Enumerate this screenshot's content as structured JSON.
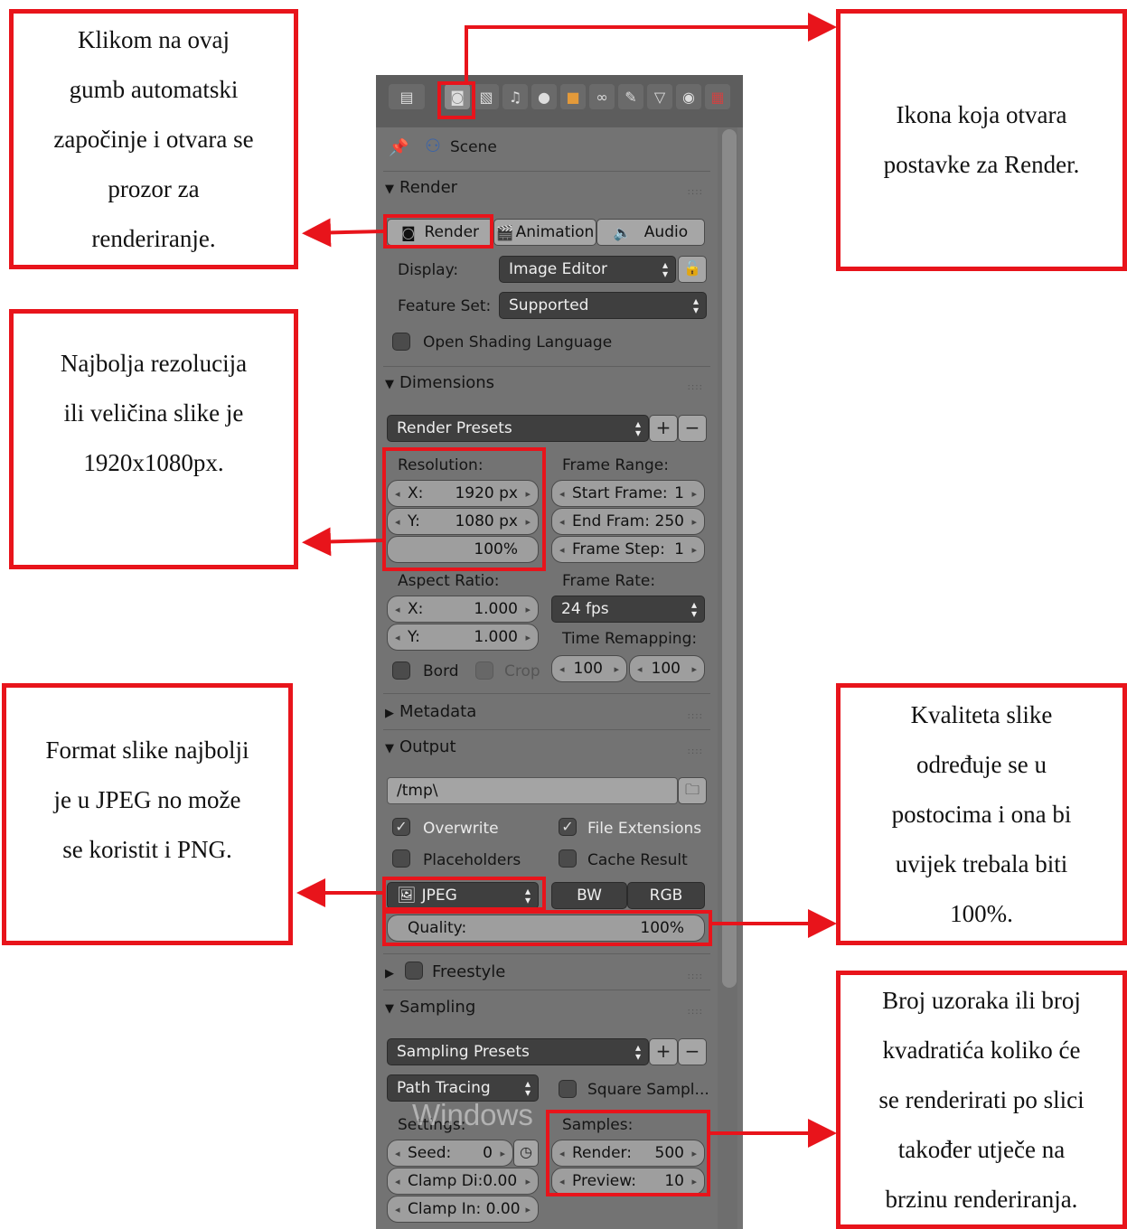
{
  "notes": {
    "render_button": [
      "Klikom na ovaj",
      "gumb automatski",
      "započinje i otvara se",
      "prozor za",
      "renderiranje."
    ],
    "render_icon": [
      "Ikona koja otvara",
      "postavke za Render."
    ],
    "resolution": [
      "Najbolja rezolucija",
      "ili veličina slike je",
      "1920x1080px."
    ],
    "format": [
      "Format slike najbolji",
      "je u JPEG no može",
      "se koristit i PNG."
    ],
    "quality": [
      "Kvaliteta slike",
      "određuje se u",
      "postocima i ona bi",
      "uvijek trebala biti",
      "100%."
    ],
    "samples": [
      "Broj uzoraka ili broj",
      "kvadratića koliko će",
      "se renderirati po slici",
      "također utječe na",
      "brzinu renderiranja."
    ]
  },
  "panel": {
    "scene_label": "Scene",
    "render_section": {
      "title": "Render",
      "render_btn": "Render",
      "animation_btn": "Animation",
      "audio_btn": "Audio",
      "display_label": "Display:",
      "display_value": "Image Editor",
      "feature_label": "Feature Set:",
      "feature_value": "Supported",
      "osl_label": "Open Shading Language"
    },
    "dimensions": {
      "title": "Dimensions",
      "presets": "Render Presets",
      "resolution_label": "Resolution:",
      "res_x_label": "X:",
      "res_x": "1920 px",
      "res_y_label": "Y:",
      "res_y": "1080 px",
      "res_pct": "100%",
      "frame_range_label": "Frame Range:",
      "start_frame_label": "Start Frame:",
      "start_frame": "1",
      "end_frame_label": "End Fram:",
      "end_frame": "250",
      "frame_step_label": "Frame Step:",
      "frame_step": "1",
      "aspect_label": "Aspect Ratio:",
      "asp_x_label": "X:",
      "asp_x": "1.000",
      "asp_y_label": "Y:",
      "asp_y": "1.000",
      "frame_rate_label": "Frame Rate:",
      "frame_rate": "24 fps",
      "time_remap_label": "Time Remapping:",
      "remap_old": "100",
      "remap_new": "100",
      "border_label": "Bord",
      "crop_label": "Crop"
    },
    "metadata_title": "Metadata",
    "output": {
      "title": "Output",
      "path": "/tmp\\",
      "overwrite": "Overwrite",
      "file_extensions": "File Extensions",
      "placeholders": "Placeholders",
      "cache_result": "Cache Result",
      "format": "JPEG",
      "bw": "BW",
      "rgb": "RGB",
      "quality_label": "Quality:",
      "quality_value": "100%"
    },
    "freestyle_title": "Freestyle",
    "sampling": {
      "title": "Sampling",
      "presets": "Sampling Presets",
      "integrator": "Path Tracing",
      "square_samples": "Square Sampl...",
      "settings_label": "Settings:",
      "seed_label": "Seed:",
      "seed": "0",
      "clamp_direct": "Clamp Di:0.00",
      "clamp_indirect": "Clamp In: 0.00",
      "samples_label": "Samples:",
      "render_label": "Render:",
      "render_samples": "500",
      "preview_label": "Preview:",
      "preview_samples": "10"
    },
    "watermark": "Windows"
  }
}
